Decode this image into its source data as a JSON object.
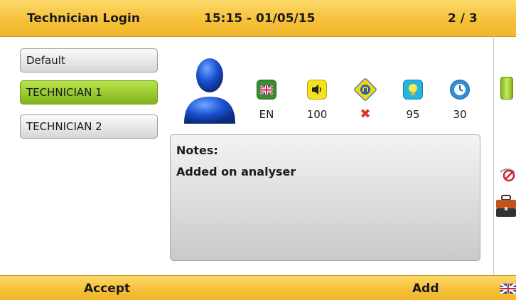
{
  "header": {
    "title": "Technician Login",
    "datetime": "15:15 - 01/05/15",
    "page_indicator": "2 / 3"
  },
  "users": [
    {
      "label": "Default",
      "selected": false
    },
    {
      "label": "TECHNICIAN 1",
      "selected": true
    },
    {
      "label": "TECHNICIAN 2",
      "selected": false
    }
  ],
  "settings": [
    {
      "icon": "language-flag-icon",
      "value": "EN"
    },
    {
      "icon": "volume-icon",
      "value": "100"
    },
    {
      "icon": "network-icon",
      "value": "✖"
    },
    {
      "icon": "brightness-icon",
      "value": "95"
    },
    {
      "icon": "timer-icon",
      "value": "30"
    }
  ],
  "notes": {
    "label": "Notes:",
    "text": "Added on analyser"
  },
  "footer": {
    "accept_label": "Accept",
    "add_label": "Add"
  },
  "colors": {
    "bar": "#f6c13a",
    "selected": "#8cc21f",
    "error": "#e0322a"
  }
}
